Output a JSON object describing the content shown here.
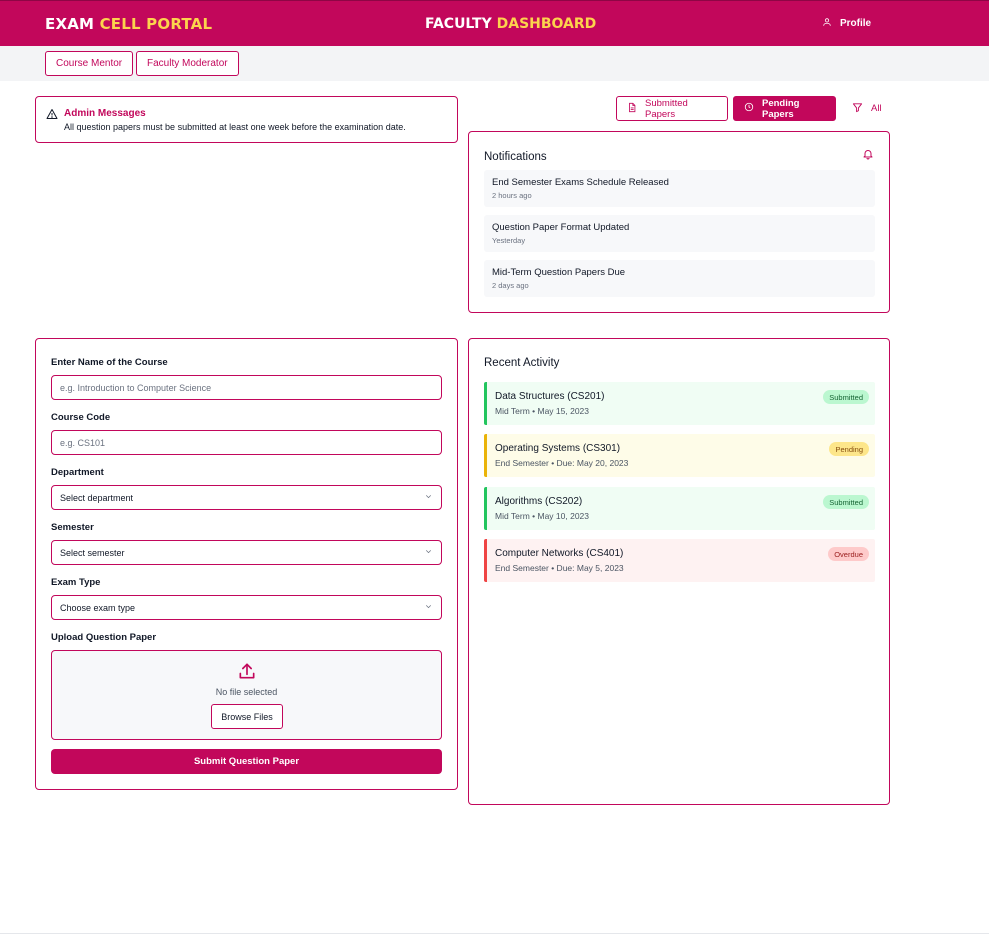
{
  "header": {
    "brand": {
      "part1": "EXAM ",
      "part2": "CELL PORTAL"
    },
    "dashboard": {
      "part1": "FACULTY ",
      "part2": "DASHBOARD"
    },
    "profile_label": "Profile",
    "icon": "user-icon"
  },
  "role_tabs": [
    {
      "label": "Course Mentor"
    },
    {
      "label": "Faculty Moderator"
    }
  ],
  "admin": {
    "title": "Admin Messages",
    "message": "All question papers must be submitted at least one week before the examination date.",
    "icon": "alert-triangle-icon"
  },
  "actions": {
    "submitted_label": "Submitted Papers",
    "pending_label": "Pending Papers",
    "all_label": "All"
  },
  "notifications": {
    "title": "Notifications",
    "icon": "bell-icon",
    "items": [
      {
        "title": "End Semester Exams Schedule Released",
        "time": "2 hours ago"
      },
      {
        "title": "Question Paper Format Updated",
        "time": "Yesterday"
      },
      {
        "title": "Mid-Term Question Papers Due",
        "time": "2 days ago"
      }
    ]
  },
  "form": {
    "course_name": {
      "label": "Enter Name of the Course",
      "placeholder": "e.g. Introduction to Computer Science",
      "value": ""
    },
    "course_code": {
      "label": "Course Code",
      "placeholder": "e.g. CS101",
      "value": ""
    },
    "department": {
      "label": "Department",
      "selected": "Select department"
    },
    "semester": {
      "label": "Semester",
      "selected": "Select semester"
    },
    "exam_type": {
      "label": "Exam Type",
      "selected": "Choose exam type"
    },
    "upload": {
      "label": "Upload Question Paper",
      "status": "No file selected",
      "browse_label": "Browse Files"
    },
    "submit_label": "Submit Question Paper"
  },
  "activity": {
    "title": "Recent Activity",
    "items": [
      {
        "title": "Data Structures (CS201)",
        "meta": "Mid Term • May 15, 2023",
        "status": "Submitted"
      },
      {
        "title": "Operating Systems (CS301)",
        "meta": "End Semester • Due: May 20, 2023",
        "status": "Pending"
      },
      {
        "title": "Algorithms (CS202)",
        "meta": "Mid Term • May 10, 2023",
        "status": "Submitted"
      },
      {
        "title": "Computer Networks (CS401)",
        "meta": "End Semester • Due: May 5, 2023",
        "status": "Overdue"
      }
    ]
  },
  "colors": {
    "brand": "#c2075b",
    "accent": "#fcd34d",
    "submitted": "#22c55e",
    "pending": "#eab308",
    "overdue": "#ef4444"
  }
}
